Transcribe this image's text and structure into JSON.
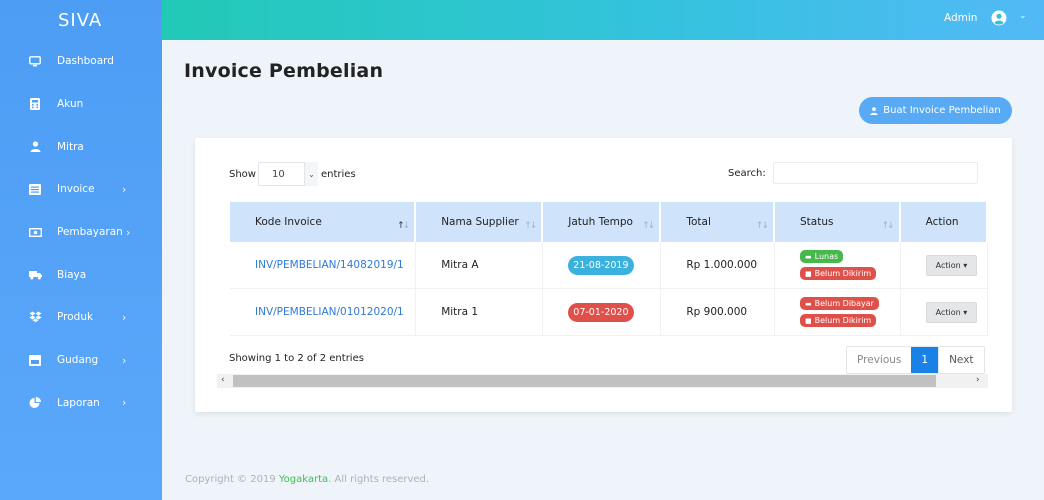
{
  "brand": "SIVA",
  "sidebar": {
    "items": [
      {
        "label": "Dashboard",
        "icon": "monitor-icon",
        "has_sub": false
      },
      {
        "label": "Akun",
        "icon": "calculator-icon",
        "has_sub": false
      },
      {
        "label": "Mitra",
        "icon": "user-icon",
        "has_sub": false
      },
      {
        "label": "Invoice",
        "icon": "list-icon",
        "has_sub": true
      },
      {
        "label": "Pembayaran",
        "icon": "money-icon",
        "has_sub": true
      },
      {
        "label": "Biaya",
        "icon": "truck-icon",
        "has_sub": false
      },
      {
        "label": "Produk",
        "icon": "dropbox-icon",
        "has_sub": true
      },
      {
        "label": "Gudang",
        "icon": "warehouse-icon",
        "has_sub": true
      },
      {
        "label": "Laporan",
        "icon": "pie-chart-icon",
        "has_sub": true
      }
    ]
  },
  "topbar": {
    "user": "Admin"
  },
  "page": {
    "title": "Invoice Pembelian",
    "create_button": "Buat Invoice Pembelian"
  },
  "table_controls": {
    "show_label": "Show",
    "entries_value": "10",
    "entries_label": "entries",
    "search_label": "Search:",
    "search_value": ""
  },
  "table": {
    "columns": [
      "Kode Invoice",
      "Nama Supplier",
      "Jatuh Tempo",
      "Total",
      "Status",
      "Action"
    ],
    "rows": [
      {
        "kode": "INV/PEMBELIAN/14082019/1",
        "supplier": "Mitra A",
        "jatuh_tempo": "21-08-2019",
        "total": "Rp 1.000.000",
        "status_payment": "Lunas",
        "status_shipping": "Belum Dikirim",
        "action": "Action"
      },
      {
        "kode": "INV/PEMBELIAN/01012020/1",
        "supplier": "Mitra 1",
        "jatuh_tempo": "07-01-2020",
        "total": "Rp 900.000",
        "status_payment": "Belum Dibayar",
        "status_shipping": "Belum Dikirim",
        "action": "Action"
      }
    ]
  },
  "info": "Showing 1 to 2 of 2 entries",
  "pagination": {
    "previous": "Previous",
    "current": "1",
    "next": "Next"
  },
  "footer": {
    "prefix": "Copyright © 2019 ",
    "brand": "Yogakarta",
    "suffix": ". All rights reserved."
  },
  "colors": {
    "sidebar": "#5aa8fb",
    "topbar_start": "#22c9b6",
    "topbar_end": "#52b9f6",
    "primary_button": "#57aaf3",
    "status_green": "#47b84b",
    "status_red": "#e0504a",
    "date_blue": "#3bb1dd",
    "link": "#2f7ad6"
  }
}
